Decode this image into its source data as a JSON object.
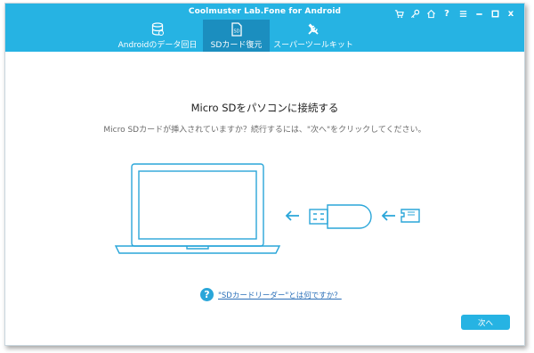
{
  "window": {
    "title": "Coolmuster Lab.Fone for Android"
  },
  "controls": {
    "cart_icon": "cart-icon",
    "key_icon": "key-icon",
    "home_icon": "home-icon",
    "help_label": "?",
    "menu_icon": "menu-icon",
    "minimize_icon": "minimize-icon",
    "maximize_icon": "maximize-icon",
    "close_label": "x"
  },
  "tabs": [
    {
      "label": "Androidのデータ回日",
      "icon": "database-icon",
      "active": false
    },
    {
      "label": "SDカード復元",
      "icon": "sd-card-icon",
      "active": true
    },
    {
      "label": "スーパーツールキット",
      "icon": "tools-icon",
      "active": false
    }
  ],
  "main": {
    "title": "Micro SDをパソコンに接続する",
    "subtitle": "Micro SDカードが挿入されていますか？続行するには、\"次へ\"をクリックしてください。",
    "help_label": "?",
    "help_link": "\"SDカードリーダー\"とは何ですか？",
    "next_button": "次へ"
  },
  "colors": {
    "accent": "#26b3e3",
    "tab_active": "#1b8ebf",
    "illustration": "#2aa6d9",
    "link": "#2a6fb8"
  }
}
